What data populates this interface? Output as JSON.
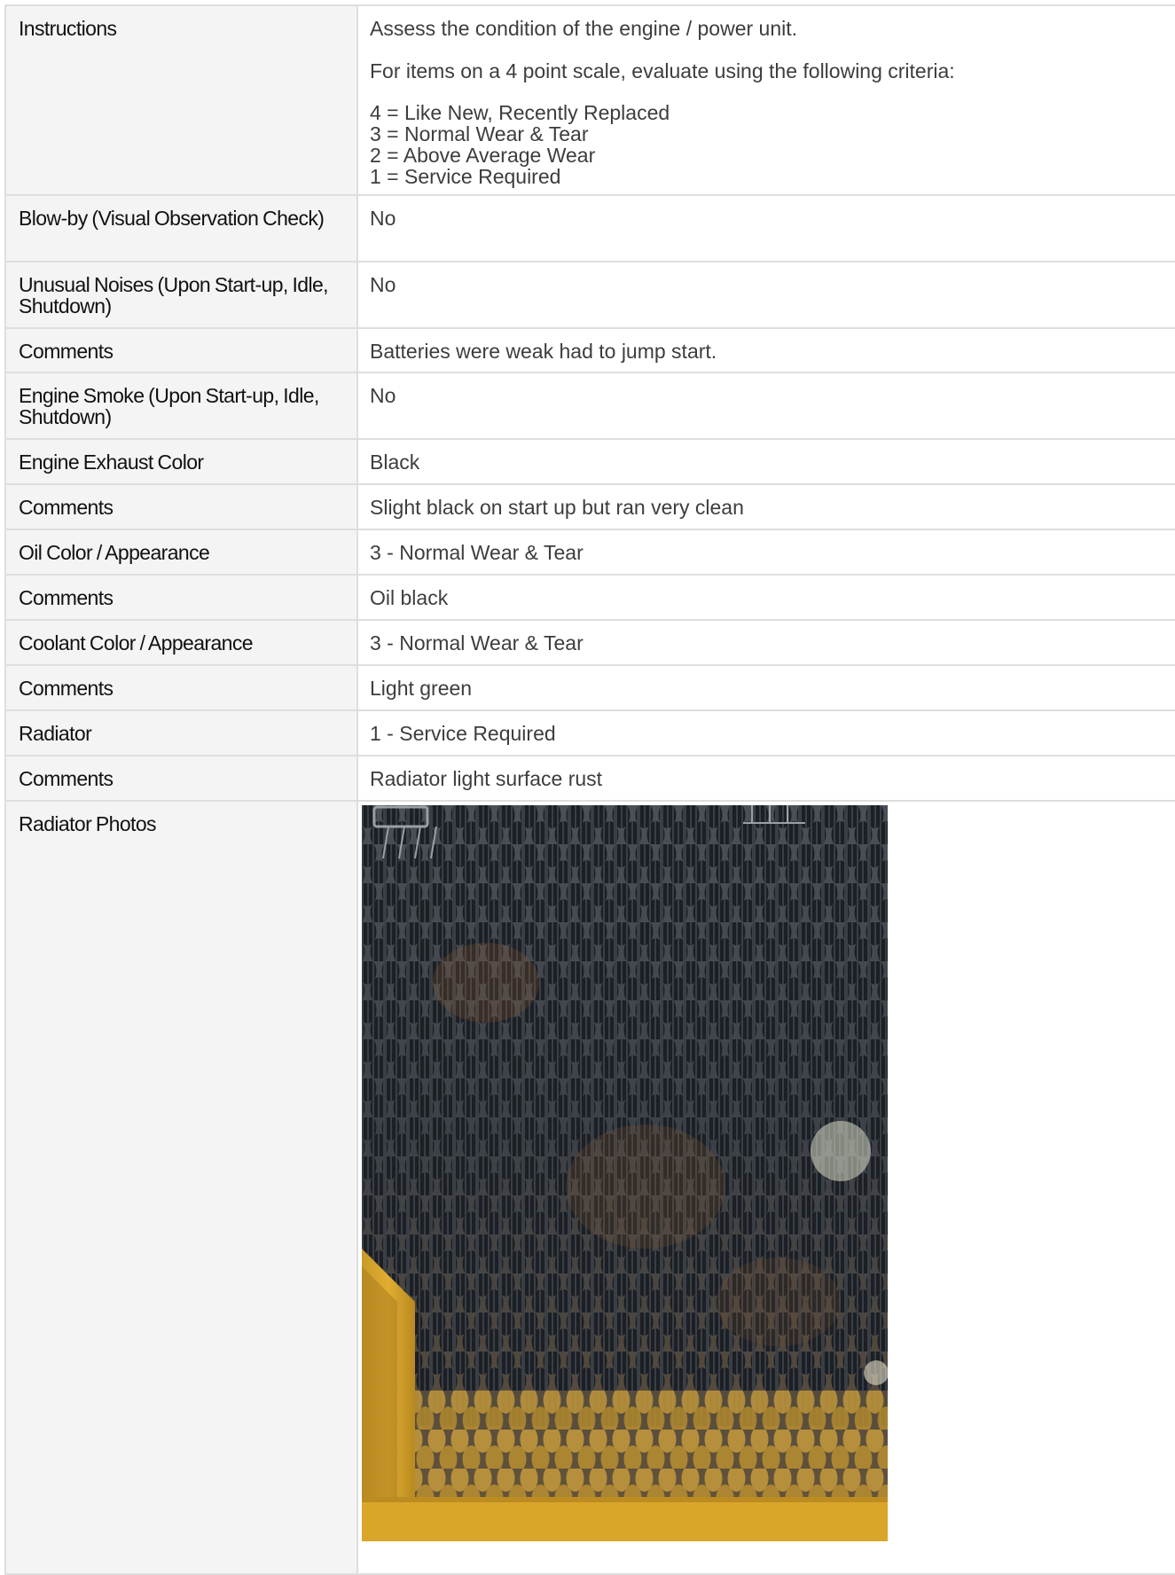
{
  "instructions": {
    "label": "Instructions",
    "intro": "Assess the condition of the engine / power unit.",
    "criteria_heading": "For items on a 4 point scale, evaluate using the following criteria:",
    "scale": [
      "4 = Like New, Recently Replaced",
      "3 = Normal Wear & Tear",
      "2 = Above Average Wear",
      "1 = Service Required"
    ]
  },
  "rows": [
    {
      "label": "Blow-by (Visual Observation Check)",
      "value": "No"
    },
    {
      "label": "Unusual Noises (Upon Start-up, Idle, Shutdown)",
      "value": "No"
    },
    {
      "label": "Comments",
      "value": "Batteries were weak had to jump start."
    },
    {
      "label": "Engine Smoke (Upon Start-up, Idle, Shutdown)",
      "value": "No"
    },
    {
      "label": "Engine Exhaust Color",
      "value": "Black"
    },
    {
      "label": "Comments",
      "value": "Slight black on start up but ran very clean"
    },
    {
      "label": "Oil Color / Appearance",
      "value": "3 - Normal Wear & Tear"
    },
    {
      "label": "Comments",
      "value": "Oil black"
    },
    {
      "label": "Coolant Color / Appearance",
      "value": "3 - Normal Wear & Tear"
    },
    {
      "label": "Comments",
      "value": "Light green"
    },
    {
      "label": "Radiator",
      "value": "1 - Service Required"
    },
    {
      "label": "Comments",
      "value": "Radiator light surface rust"
    }
  ],
  "photos": {
    "label": "Radiator Photos",
    "image_subject": "radiator-grille-photo"
  },
  "colors": {
    "label_bg": "#f4f4f4",
    "border": "#dedede",
    "label_text": "#111111",
    "value_text": "#3d3d3d",
    "grille_metal": "#3b4046",
    "rust": "#8a5a30",
    "frame_yellow": "#d9a62a"
  }
}
